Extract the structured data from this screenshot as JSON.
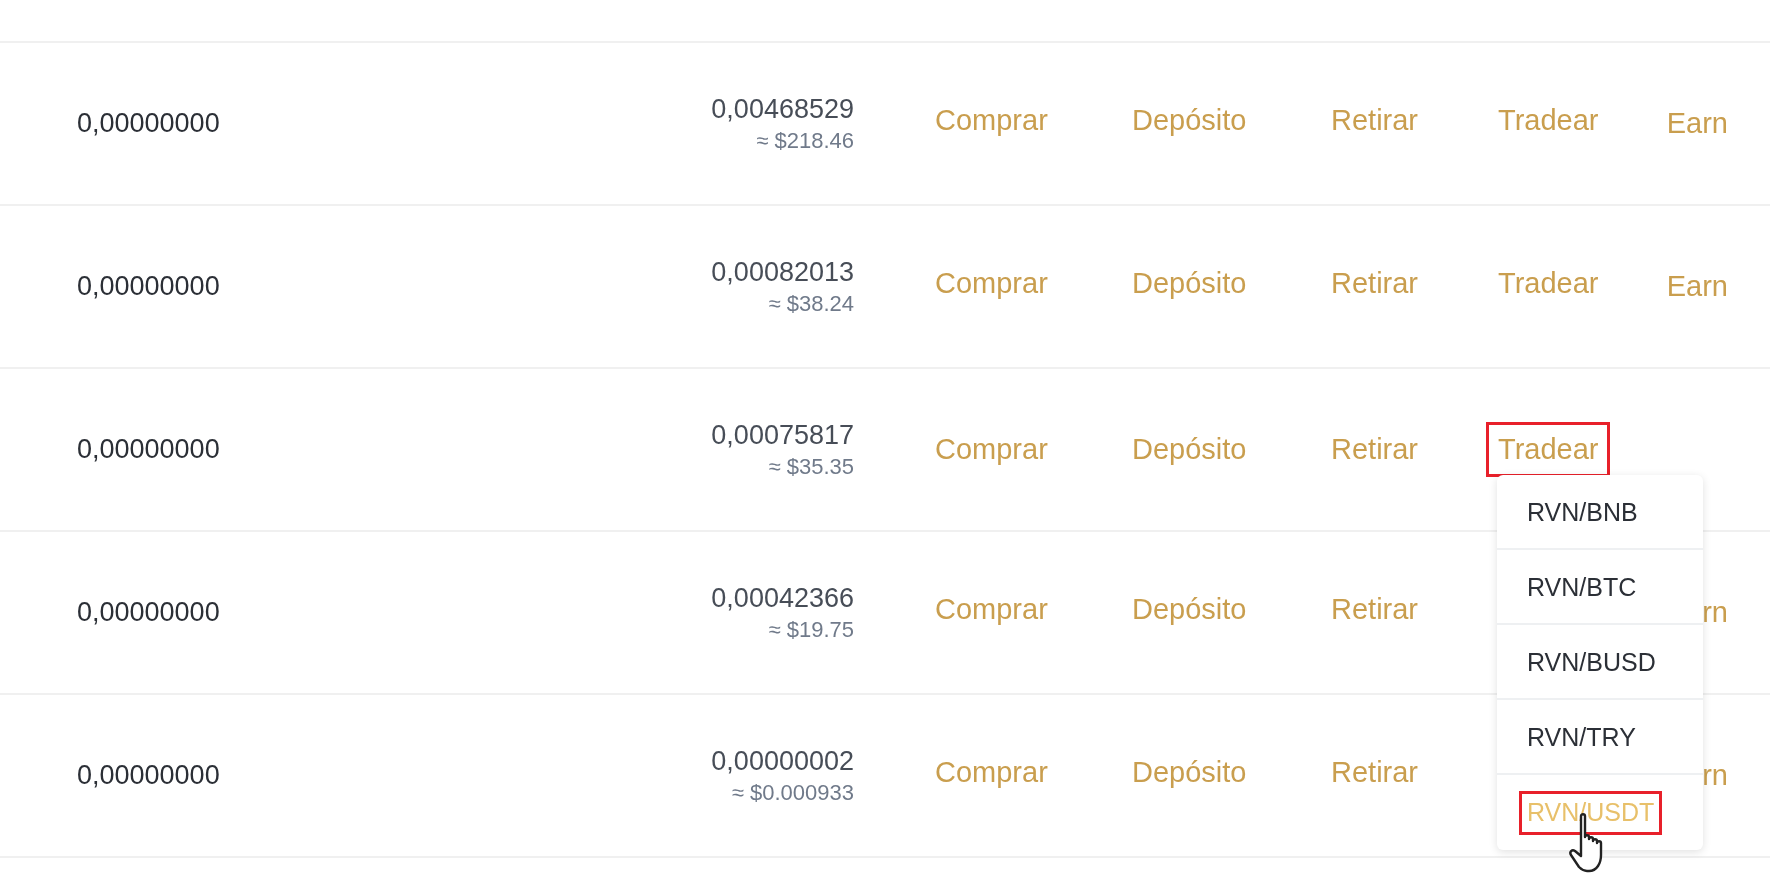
{
  "rows": [
    {
      "available": "0,00000000",
      "balance": "0,00468529",
      "usd": "≈ $218.46",
      "actions": [
        {
          "label": "Comprar",
          "highlighted": false
        },
        {
          "label": "Depósito",
          "highlighted": false
        },
        {
          "label": "Retirar",
          "highlighted": false
        },
        {
          "label": "Tradear",
          "highlighted": false
        }
      ],
      "earn": "Earn"
    },
    {
      "available": "0,00000000",
      "balance": "0,00082013",
      "usd": "≈ $38.24",
      "actions": [
        {
          "label": "Comprar",
          "highlighted": false
        },
        {
          "label": "Depósito",
          "highlighted": false
        },
        {
          "label": "Retirar",
          "highlighted": false
        },
        {
          "label": "Tradear",
          "highlighted": false
        }
      ],
      "earn": "Earn"
    },
    {
      "available": "0,00000000",
      "balance": "0,00075817",
      "usd": "≈ $35.35",
      "actions": [
        {
          "label": "Comprar",
          "highlighted": false
        },
        {
          "label": "Depósito",
          "highlighted": false
        },
        {
          "label": "Retirar",
          "highlighted": false
        },
        {
          "label": "Tradear",
          "highlighted": true
        }
      ],
      "trade_menu": {
        "options": [
          {
            "label": "RVN/BNB",
            "hovered": false,
            "highlighted": false
          },
          {
            "label": "RVN/BTC",
            "hovered": false,
            "highlighted": false
          },
          {
            "label": "RVN/BUSD",
            "hovered": false,
            "highlighted": false
          },
          {
            "label": "RVN/TRY",
            "hovered": false,
            "highlighted": false
          },
          {
            "label": "RVN/USDT",
            "hovered": true,
            "highlighted": true
          }
        ]
      }
    },
    {
      "available": "0,00000000",
      "balance": "0,00042366",
      "usd": "≈ $19.75",
      "actions": [
        {
          "label": "Comprar",
          "highlighted": false
        },
        {
          "label": "Depósito",
          "highlighted": false
        },
        {
          "label": "Retirar",
          "highlighted": false
        }
      ],
      "earn": "rn"
    },
    {
      "available": "0,00000000",
      "balance": "0,00000002",
      "usd": "≈ $0.000933",
      "actions": [
        {
          "label": "Comprar",
          "highlighted": false
        },
        {
          "label": "Depósito",
          "highlighted": false
        },
        {
          "label": "Retirar",
          "highlighted": false
        }
      ],
      "earn": "rn"
    }
  ]
}
